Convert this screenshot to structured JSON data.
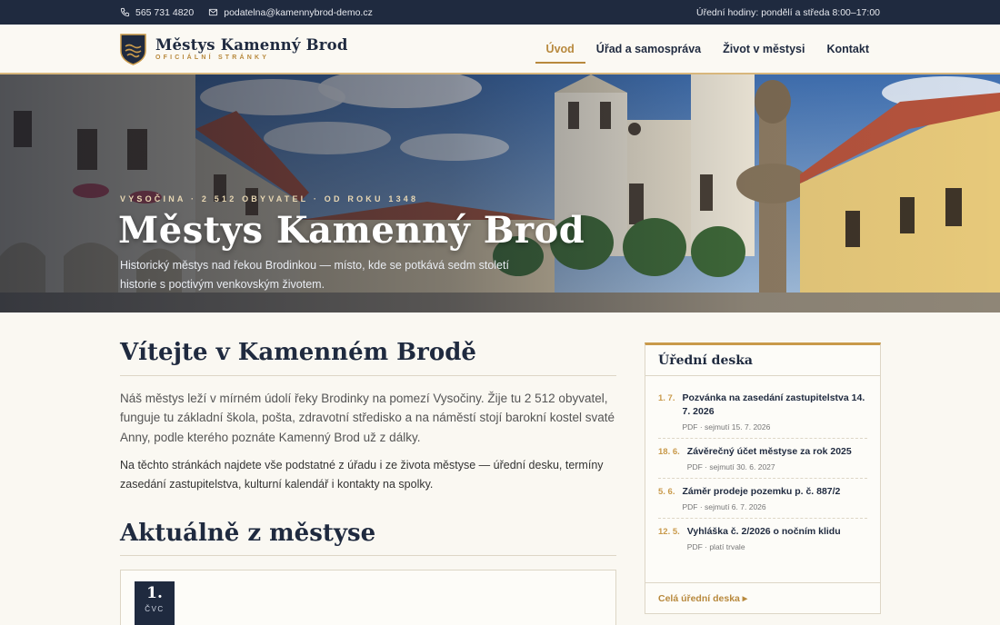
{
  "topbar": {
    "phone": "565 731 4820",
    "email": "podatelna@kamennybrod-demo.cz",
    "hours": "Úřední hodiny: pondělí a středa 8:00–17:00"
  },
  "header": {
    "site_name": "Městys Kamenný Brod",
    "site_sub": "OFICIÁLNÍ STRÁNKY",
    "nav": [
      {
        "label": "Úvod",
        "active": true
      },
      {
        "label": "Úřad a samospráva",
        "active": false
      },
      {
        "label": "Život v městysi",
        "active": false
      },
      {
        "label": "Kontakt",
        "active": false
      }
    ]
  },
  "hero": {
    "kicker": "VYSOČINA · 2 512 OBYVATEL · OD ROKU 1348",
    "title": "Městys Kamenný Brod",
    "description": "Historický městys nad řekou Brodinkou — místo, kde se potkává sedm století historie s poctivým venkovským životem."
  },
  "main": {
    "welcome_title": "Vítejte v Kamenném Brodě",
    "intro": "Náš městys leží v mírném údolí řeky Brodinky na pomezí Vysočiny. Žije tu 2 512 obyvatel, funguje tu základní škola, pošta, zdravotní středisko a na náměstí stojí barokní kostel svaté Anny, podle kterého poznáte Kamenný Brod už z dálky.",
    "intro2": "Na těchto stránkách najdete vše podstatné z úřadu i ze života městyse — úřední desku, termíny zasedání zastupitelstva, kulturní kalendář i kontakty na spolky.",
    "news_title": "Aktuálně z městyse",
    "news": [
      {
        "day": "1.",
        "month": "ČVC"
      }
    ]
  },
  "board": {
    "title": "Úřední deska",
    "items": [
      {
        "date": "1. 7.",
        "title": "Pozvánka na zasedání zastupitelstva 14. 7. 2026",
        "meta": "PDF · sejmutí 15. 7. 2026"
      },
      {
        "date": "18. 6.",
        "title": "Závěrečný účet městyse za rok 2025",
        "meta": "PDF · sejmutí 30. 6. 2027"
      },
      {
        "date": "5. 6.",
        "title": "Záměr prodeje pozemku p. č. 887/2",
        "meta": "PDF · sejmutí 6. 7. 2026"
      },
      {
        "date": "12. 5.",
        "title": "Vyhláška č. 2/2026 o nočním klidu",
        "meta": "PDF · platí trvale"
      }
    ],
    "footer_link": "Celá úřední deska ▸"
  },
  "colors": {
    "navy": "#1f2a3f",
    "gold": "#b8893d",
    "background": "#faf8f2"
  }
}
